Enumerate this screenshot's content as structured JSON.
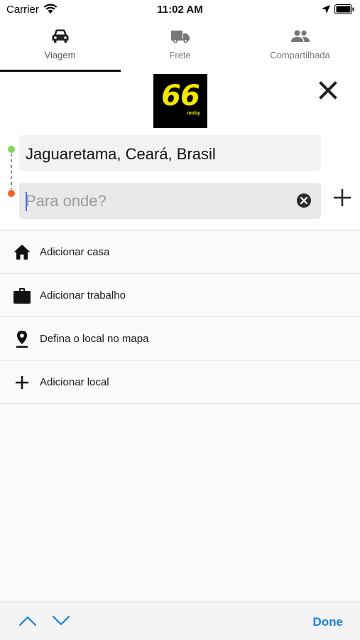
{
  "status_bar": {
    "carrier": "Carrier",
    "time": "11:02 AM"
  },
  "tabs": [
    {
      "label": "Viagem",
      "icon": "car-icon",
      "active": true
    },
    {
      "label": "Frete",
      "icon": "truck-icon",
      "active": false
    },
    {
      "label": "Compartilhada",
      "icon": "group-icon",
      "active": false
    }
  ],
  "logo": {
    "number": "66",
    "sub": "moby"
  },
  "route": {
    "origin": "Jaguaretama, Ceará, Brasil",
    "destination_placeholder": "Para onde?",
    "destination_value": "",
    "origin_dot_color": "#7ed957",
    "dest_dot_color": "#f26322"
  },
  "list": [
    {
      "label": "Adicionar casa",
      "icon": "home-icon"
    },
    {
      "label": "Adicionar trabalho",
      "icon": "briefcase-icon"
    },
    {
      "label": "Defina o local no mapa",
      "icon": "map-pin-icon"
    },
    {
      "label": "Adicionar local",
      "icon": "plus-icon"
    }
  ],
  "keyboard_toolbar": {
    "done_label": "Done",
    "accent": "#1a7fe0"
  }
}
